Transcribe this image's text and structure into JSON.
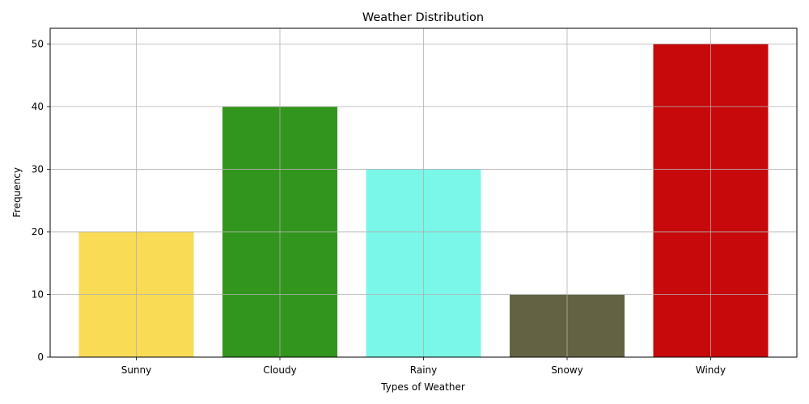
{
  "chart_data": {
    "type": "bar",
    "title": "Weather Distribution",
    "xlabel": "Types of Weather",
    "ylabel": "Frequency",
    "categories": [
      "Sunny",
      "Cloudy",
      "Rainy",
      "Snowy",
      "Windy"
    ],
    "values": [
      20,
      40,
      30,
      10,
      50
    ],
    "colors": [
      "#f9db55",
      "#32951d",
      "#7af7e8",
      "#636343",
      "#c8090b"
    ],
    "ylim": [
      0,
      52.5
    ],
    "yticks": [
      0,
      10,
      20,
      30,
      40,
      50
    ],
    "grid": true,
    "legend": "none"
  }
}
